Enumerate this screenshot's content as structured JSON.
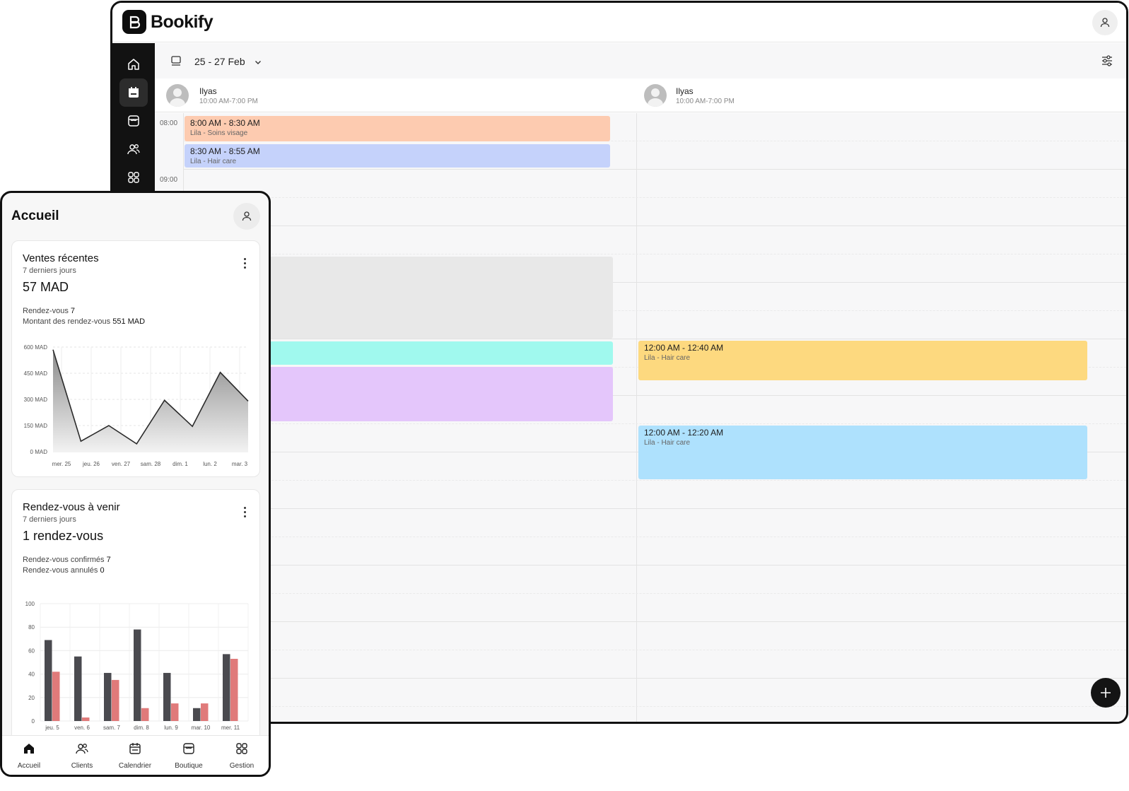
{
  "desktop": {
    "app_name": "Bookify",
    "toolbar": {
      "date_range": "25 - 27 Feb"
    },
    "resources": [
      {
        "name": "Ilyas",
        "hours": "10:00 AM-7:00 PM"
      },
      {
        "name": "Ilyas",
        "hours": "10:00 AM-7:00 PM"
      }
    ],
    "hours": [
      "08:00",
      "09:00"
    ],
    "appointments": [
      {
        "time": "8:00 AM - 8:30 AM",
        "detail": "Lila - Soins visage",
        "color": "#fdcbb0"
      },
      {
        "time": "8:30 AM - 8:55 AM",
        "detail": "Lila - Hair care",
        "color": "#c5d2fb"
      },
      {
        "time": "12:00 AM - 12:40 AM",
        "detail": "Lila - Hair care",
        "color": "#fdd97f"
      },
      {
        "time": "12:00 AM - 12:20 AM",
        "detail": "Lila - Hair care",
        "color": "#aee1fd"
      }
    ],
    "block_colors": [
      "#e8e8e8",
      "#a0f9ee",
      "#e4c6fb"
    ]
  },
  "mobile": {
    "title": "Accueil",
    "sales": {
      "title": "Ventes récentes",
      "period": "7 derniers jours",
      "total": "57 MAD",
      "appointments_label": "Rendez-vous",
      "appointments_value": "7",
      "amount_label": "Montant des rendez-vous",
      "amount_value": "551 MAD"
    },
    "upcoming": {
      "title": "Rendez-vous à venir",
      "period": "7 derniers jours",
      "total": "1 rendez-vous",
      "confirmed_label": "Rendez-vous confirmés",
      "confirmed_value": "7",
      "cancelled_label": "Rendez-vous annulés",
      "cancelled_value": "0"
    },
    "nav": [
      "Accueil",
      "Clients",
      "Calendrier",
      "Boutique",
      "Gestion"
    ]
  },
  "chart_data": [
    {
      "type": "area",
      "categories": [
        "mer. 25",
        "jeu. 26",
        "ven. 27",
        "sam. 28",
        "dim. 1",
        "lun. 2",
        "mar. 3"
      ],
      "series": [
        {
          "values": [
            585,
            60,
            150,
            45,
            295,
            145,
            455,
            290
          ]
        }
      ],
      "ytick_labels": [
        "0 MAD",
        "150 MAD",
        "300 MAD",
        "450 MAD",
        "600 MAD"
      ],
      "ylim": [
        0,
        600
      ],
      "grid": true,
      "colors": {
        "line": "#2a2a2a",
        "fill_top": "#8a8a8a",
        "fill_bottom": "#f2f2f2"
      }
    },
    {
      "type": "bar",
      "categories": [
        "jeu. 5",
        "ven. 6",
        "sam. 7",
        "dim. 8",
        "lun. 9",
        "mar. 10",
        "mer. 11"
      ],
      "series": [
        {
          "values": [
            69,
            55,
            41,
            78,
            41,
            11,
            57
          ],
          "color": "#4a4a4f"
        },
        {
          "values": [
            42,
            3,
            35,
            11,
            15,
            15,
            53
          ],
          "color": "#e07a7a"
        }
      ],
      "ytick_labels": [
        "0",
        "20",
        "40",
        "60",
        "80",
        "100"
      ],
      "ylim": [
        0,
        100
      ],
      "grid": true
    }
  ]
}
